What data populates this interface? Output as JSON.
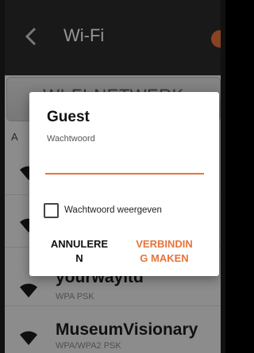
{
  "appbar": {
    "title": "Wi-Fi",
    "back_icon": "chevron-left-icon",
    "toggle_state": "on",
    "accent": "#e8743b"
  },
  "list": {
    "section_button_label": "WI-FI-NETWERK",
    "side_letter": "A",
    "networks": [
      {
        "name": "",
        "security": "",
        "icon": "wifi-icon"
      },
      {
        "name": "",
        "security": "",
        "icon": "wifi-icon"
      },
      {
        "name": "yourwayltd",
        "security": "WPA PSK",
        "icon": "wifi-icon"
      },
      {
        "name": "MuseumVisionary",
        "security": "WPA/WPA2 PSK",
        "icon": "wifi-icon"
      }
    ]
  },
  "dialog": {
    "title": "Guest",
    "password_label": "Wachtwoord",
    "password_value": "",
    "show_password_label": "Wachtwoord weergeven",
    "show_password_checked": false,
    "cancel_label": "ANNULERE\nN",
    "connect_label": "VERBINDIN\nG MAKEN"
  }
}
